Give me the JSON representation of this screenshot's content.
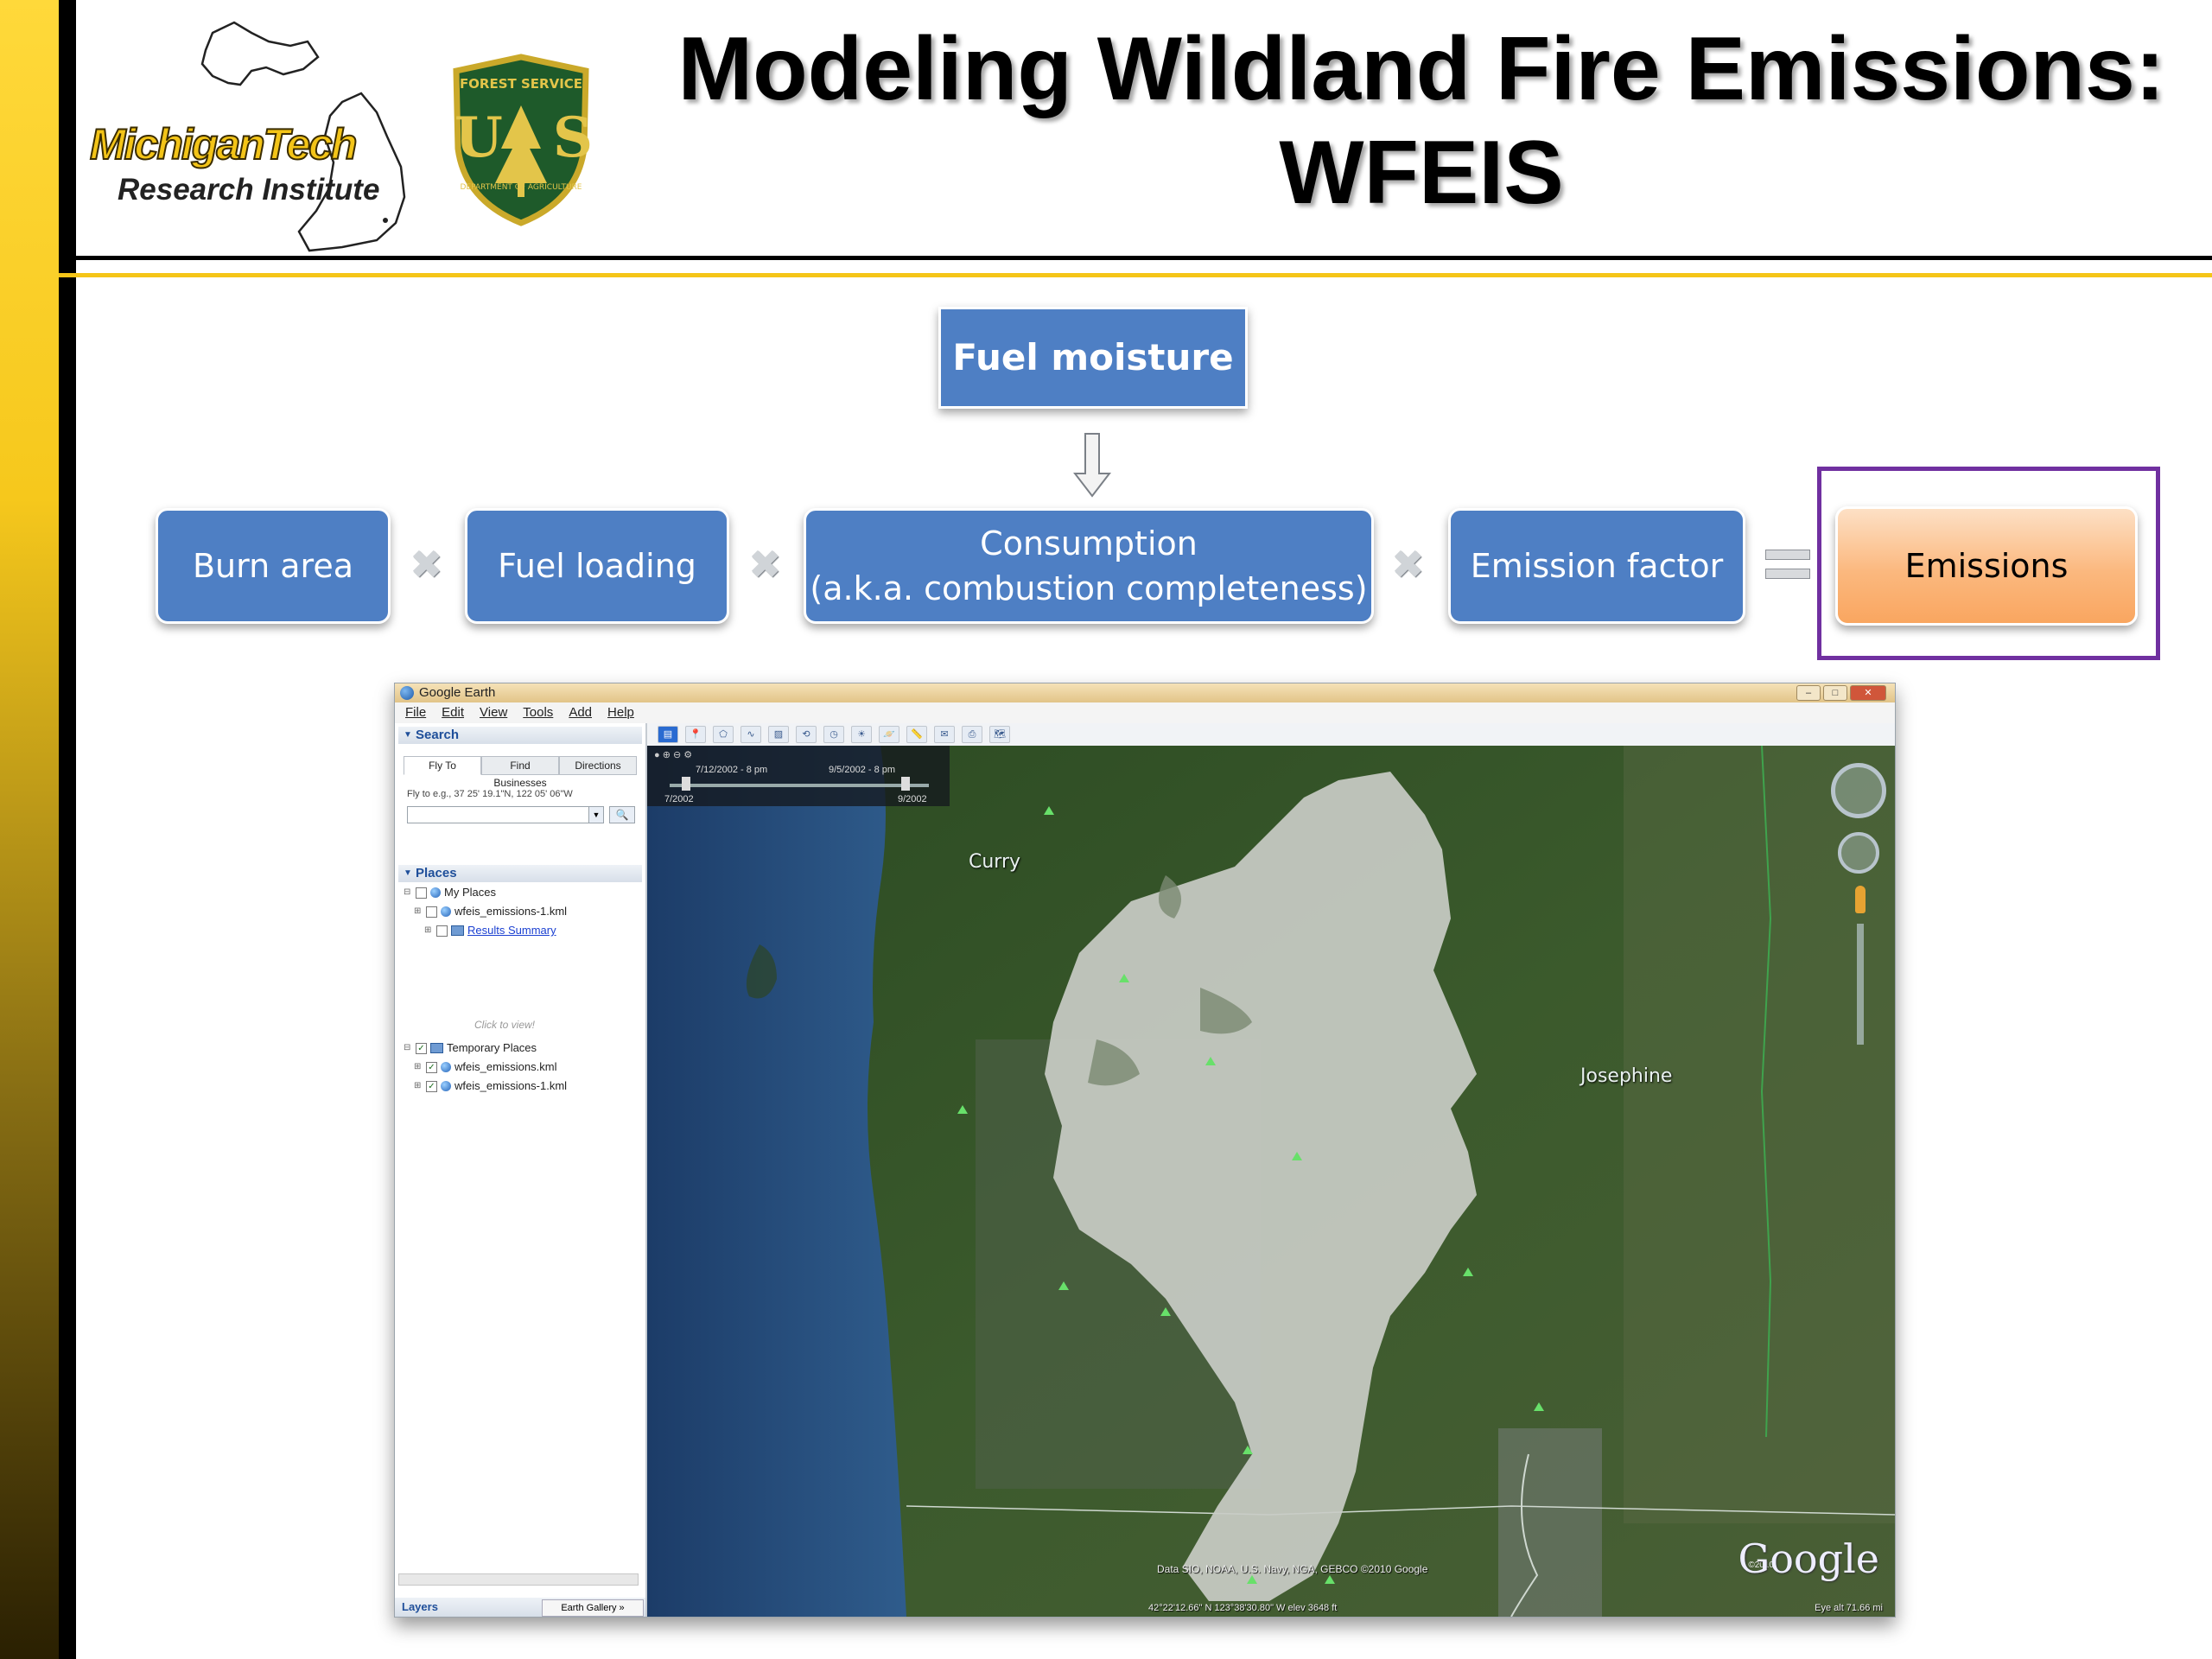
{
  "header": {
    "title_line1": "Modeling Wildland Fire Emissions:",
    "title_line2": "WFEIS",
    "logo_mtu": {
      "line1": "MichiganTech",
      "line2": "Research Institute"
    },
    "logo_usfs": {
      "top_text": "FOREST SERVICE",
      "center_text": "US",
      "bottom_text": "DEPARTMENT OF AGRICULTURE"
    }
  },
  "diagram": {
    "fuel_moisture": "Fuel moisture",
    "burn_area": "Burn area",
    "fuel_loading": "Fuel loading",
    "consumption_line1": "Consumption",
    "consumption_line2": "(a.k.a. combustion completeness)",
    "emission_factor": "Emission factor",
    "emissions": "Emissions",
    "multiply_symbol": "✖",
    "colors": {
      "box_blue": "#4e7fc4",
      "emissions_orange": "#f9a660",
      "highlight_purple": "#7030a0"
    }
  },
  "google_earth": {
    "window_title": "Google Earth",
    "menu": [
      "File",
      "Edit",
      "View",
      "Tools",
      "Add",
      "Help"
    ],
    "search_header": "Search",
    "tabs": [
      "Fly To",
      "Find Businesses",
      "Directions"
    ],
    "fly_hint": "Fly to e.g., 37 25' 19.1\"N, 122 05' 06\"W",
    "search_value": "",
    "places_header": "Places",
    "tree": {
      "my_places": "My Places",
      "kml1": "wfeis_emissions-1.kml",
      "results_summary": "Results Summary",
      "click_to_view": "Click to view!",
      "temporary_places": "Temporary Places",
      "kml2": "wfeis_emissions.kml",
      "kml3": "wfeis_emissions-1.kml"
    },
    "layers_label": "Layers",
    "earth_gallery": "Earth Gallery »",
    "time_slider": {
      "start_label": "7/12/2002 - 8 pm",
      "end_label": "9/5/2002 - 8 pm",
      "left_date": "7/2002",
      "right_date": "9/2002"
    },
    "map_labels": {
      "curry": "Curry",
      "josephine": "Josephine"
    },
    "watermark": "Google",
    "copyright_year": "©2010",
    "credit": "Data SIO, NOAA, U.S. Navy, NGA, GEBCO\n©2010 Google",
    "status": "42°22'12.66\" N 123°38'30.80\" W elev 3648 ft",
    "eye_alt": "Eye alt  71.66 mi"
  }
}
